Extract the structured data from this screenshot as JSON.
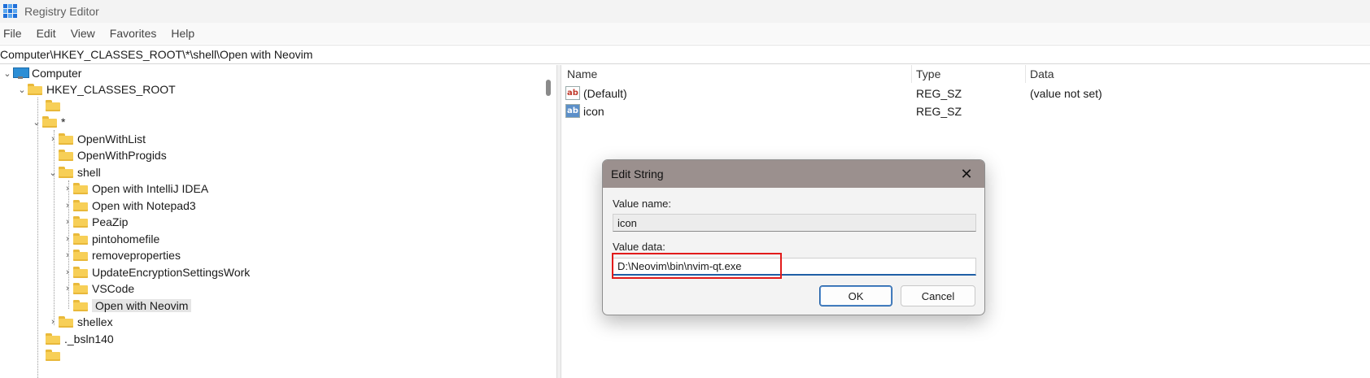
{
  "window": {
    "title": "Registry Editor"
  },
  "menu": [
    "File",
    "Edit",
    "View",
    "Favorites",
    "Help"
  ],
  "address": "Computer\\HKEY_CLASSES_ROOT\\*\\shell\\Open with Neovim",
  "tree": {
    "computer": "Computer",
    "hkcr": "HKEY_CLASSES_ROOT",
    "blank": "",
    "star": "*",
    "open_with_list": "OpenWithList",
    "open_with_progids": "OpenWithProgids",
    "shell": "shell",
    "shell_children": [
      "Open with IntelliJ IDEA",
      "Open with Notepad3",
      "PeaZip",
      "pintohomefile",
      "removeproperties",
      "UpdateEncryptionSettingsWork",
      "VSCode",
      "Open with Neovim"
    ],
    "shellex": "shellex",
    "bsln140": "._bsln140"
  },
  "list": {
    "headers": {
      "name": "Name",
      "type": "Type",
      "data": "Data"
    },
    "rows": [
      {
        "name": "(Default)",
        "type": "REG_SZ",
        "data": "(value not set)",
        "icon": "string-value-icon"
      },
      {
        "name": "icon",
        "type": "REG_SZ",
        "data": "",
        "icon": "string-value-icon-selected"
      }
    ]
  },
  "dialog": {
    "title": "Edit String",
    "close_glyph": "✕",
    "value_name_label": "Value name:",
    "value_name": "icon",
    "value_data_label": "Value data:",
    "value_data": "D:\\Neovim\\bin\\nvim-qt.exe",
    "ok": "OK",
    "cancel": "Cancel"
  },
  "colors": {
    "highlight_box": "#e21b1b",
    "dialog_titlebar": "#9b908e",
    "accent": "#1f5fa6"
  }
}
